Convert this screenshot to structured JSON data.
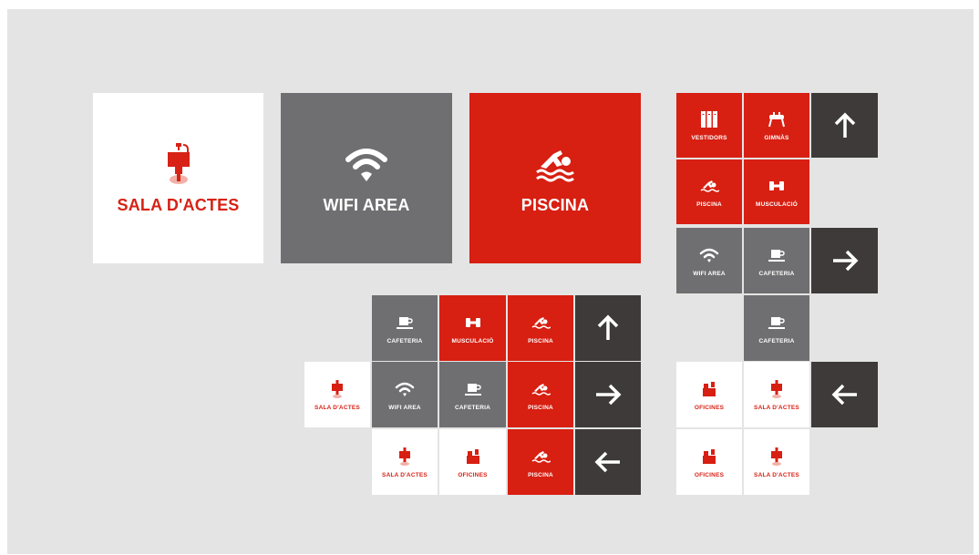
{
  "colors": {
    "red": "#d71f12",
    "gray": "#6f6f71",
    "dark": "#3e3a3a",
    "white": "#ffffff",
    "background": "#e4e4e4"
  },
  "big_tiles": [
    {
      "label": "SALA D'ACTES",
      "icon": "podium-icon",
      "style": "white"
    },
    {
      "label": "WIFI AREA",
      "icon": "wifi-icon",
      "style": "gray"
    },
    {
      "label": "PISCINA",
      "icon": "swimmer-icon",
      "style": "red"
    }
  ],
  "labels": {
    "vestidors": "VESTIDORS",
    "gimnas": "GIMNÀS",
    "piscina": "PISCINA",
    "musculacio": "MUSCULACIÓ",
    "wifi": "WIFI AREA",
    "cafeteria": "CAFETERIA",
    "sala": "SALA D'ACTES",
    "oficines": "OFICINES"
  },
  "arrows": [
    "up",
    "right",
    "left"
  ]
}
